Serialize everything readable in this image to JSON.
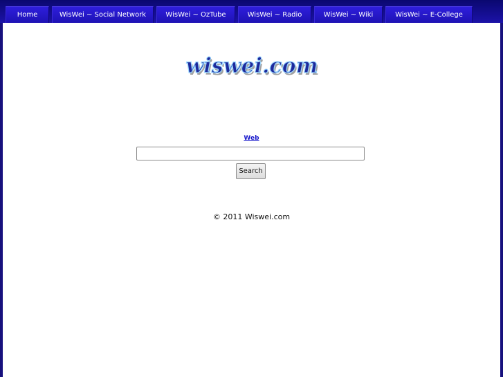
{
  "nav": {
    "items": [
      {
        "label": "Home"
      },
      {
        "label": "WisWei ~ Social Network"
      },
      {
        "label": "WisWei ~ OzTube"
      },
      {
        "label": "WisWei ~ Radio"
      },
      {
        "label": "WisWei ~ Wiki"
      },
      {
        "label": "WisWei ~ E-College"
      }
    ]
  },
  "logo": {
    "text": "wiswei.com"
  },
  "search": {
    "tab_label": "Web",
    "input_value": "",
    "button_label": "Search"
  },
  "footer": {
    "copyright": "© 2011 Wiswei.com"
  },
  "colors": {
    "frame": "#2a18d8",
    "nav_tab": "#2e1edc",
    "link": "#1a1acc",
    "logo_fill": "#1e2a9c"
  }
}
